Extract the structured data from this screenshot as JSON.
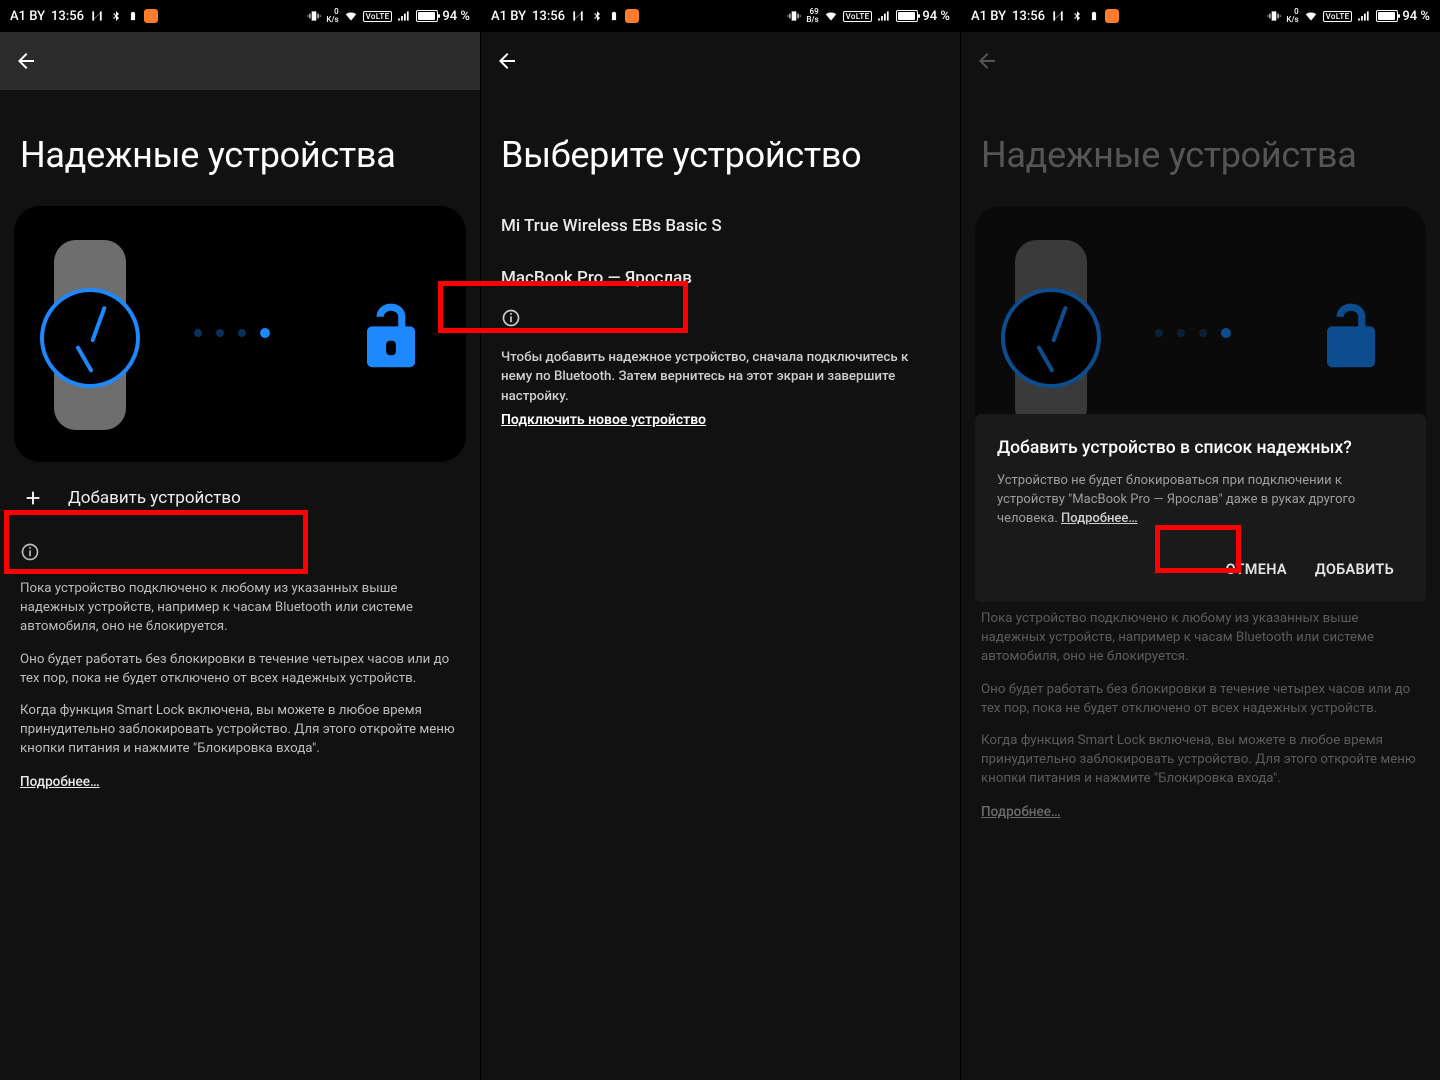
{
  "status": {
    "carrier": "A1 BY",
    "time": "13:56",
    "battery_pct": "94 %",
    "kbps1": "0",
    "kbps1_unit": "K/s",
    "kbps2": "69",
    "kbps2_unit": "B/s",
    "volte": "VoLTE"
  },
  "panel1": {
    "title": "Надежные устройства",
    "add_label": "Добавить устройство",
    "info_p1": "Пока устройство подключено к любому из указанных выше надежных устройств, например к часам Bluetooth или системе автомобиля, оно не блокируется.",
    "info_p2": "Оно будет работать без блокировки в течение четырех часов или до тех пор, пока не будет отключено от всех надежных устройств.",
    "info_p3": "Когда функция Smart Lock включена, вы можете в любое время принудительно заблокировать устройство. Для этого откройте меню кнопки питания и нажмите \"Блокировка входа\".",
    "more": "Подробнее…"
  },
  "panel2": {
    "title": "Выберите устройство",
    "device1": "Mi True Wireless EBs Basic S",
    "device2": "MacBook Pro — Ярослав",
    "note": "Чтобы добавить надежное устройство, сначала подключитесь к нему по Bluetooth. Затем вернитесь на этот экран и завершите настройку.",
    "connect": "Подключить новое устройство"
  },
  "panel3": {
    "title": "Надежные устройства",
    "dialog_title": "Добавить устройство в список надежных?",
    "dialog_body_a": "Устройство не будет блокироваться при подключении к устройству \"MacBook Pro — Ярослав\" даже в руках другого человека. ",
    "dialog_more": "Подробнее…",
    "cancel": "ОТМЕНА",
    "confirm": "ДОБАВИТЬ",
    "info_p1": "Пока устройство подключено к любому из указанных выше надежных устройств, например к часам Bluetooth или системе автомобиля, оно не блокируется.",
    "info_p2": "Оно будет работать без блокировки в течение четырех часов или до тех пор, пока не будет отключено от всех надежных устройств.",
    "info_p3": "Когда функция Smart Lock включена, вы можете в любое время принудительно заблокировать устройство. Для этого откройте меню кнопки питания и нажмите \"Блокировка входа\".",
    "more": "Подробнее…"
  }
}
